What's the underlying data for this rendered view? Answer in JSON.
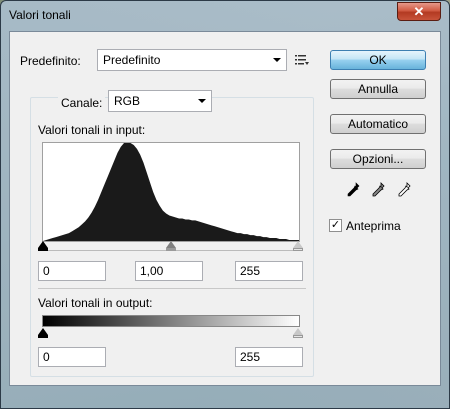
{
  "window": {
    "title": "Valori tonali",
    "close_glyph": "✕"
  },
  "preset": {
    "label": "Predefinito:",
    "value": "Predefinito",
    "menu_icon": "preset-menu-icon"
  },
  "channel": {
    "label": "Canale:",
    "value": "RGB"
  },
  "input_levels": {
    "label": "Valori tonali in input:",
    "black": "0",
    "gamma": "1,00",
    "white": "255",
    "histogram": [
      0,
      0.01,
      0.02,
      0.03,
      0.04,
      0.05,
      0.06,
      0.07,
      0.08,
      0.1,
      0.12,
      0.14,
      0.17,
      0.2,
      0.24,
      0.29,
      0.35,
      0.42,
      0.5,
      0.58,
      0.66,
      0.74,
      0.82,
      0.9,
      0.96,
      1,
      1,
      1,
      0.98,
      0.94,
      0.88,
      0.8,
      0.7,
      0.6,
      0.5,
      0.42,
      0.36,
      0.31,
      0.28,
      0.26,
      0.25,
      0.24,
      0.23,
      0.23,
      0.22,
      0.22,
      0.21,
      0.21,
      0.2,
      0.19,
      0.18,
      0.17,
      0.16,
      0.15,
      0.14,
      0.13,
      0.12,
      0.11,
      0.1,
      0.09,
      0.08,
      0.08,
      0.07,
      0.07,
      0.06,
      0.06,
      0.05,
      0.05,
      0.04,
      0.04,
      0.03,
      0.03,
      0.03,
      0.02,
      0.02,
      0.02,
      0.01,
      0.01,
      0.01,
      0.01
    ]
  },
  "output_levels": {
    "label": "Valori tonali in output:",
    "black": "0",
    "white": "255"
  },
  "buttons": {
    "ok": "OK",
    "cancel": "Annulla",
    "auto": "Automatico",
    "options": "Opzioni..."
  },
  "eyedroppers": [
    "black-eyedropper-icon",
    "gray-eyedropper-icon",
    "white-eyedropper-icon"
  ],
  "preview": {
    "label": "Anteprima",
    "checked": true,
    "check_glyph": "✓"
  }
}
